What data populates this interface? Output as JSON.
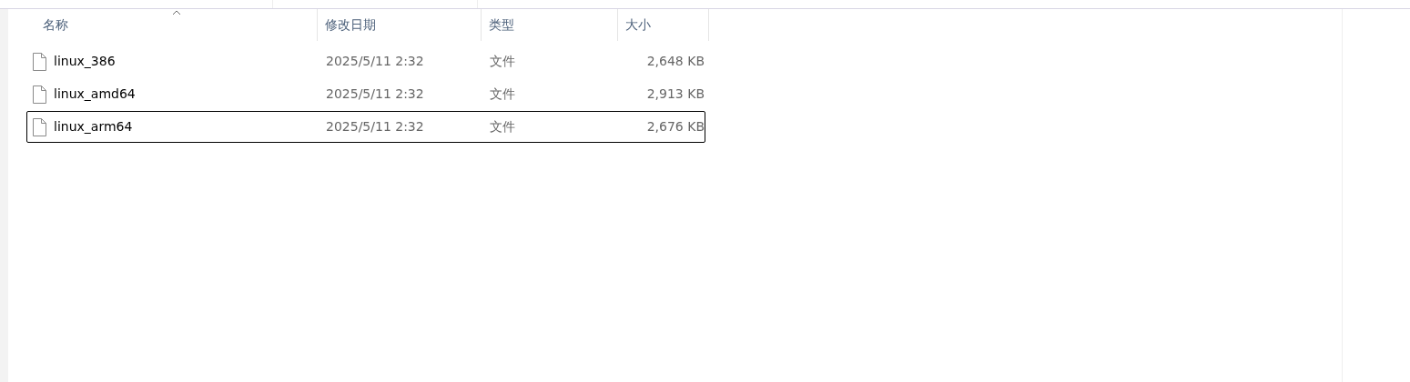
{
  "file_list": {
    "columns": [
      {
        "label": "名称",
        "sorted": true
      },
      {
        "label": "修改日期",
        "sorted": false
      },
      {
        "label": "类型",
        "sorted": false
      },
      {
        "label": "大小",
        "sorted": false
      }
    ],
    "rows": [
      {
        "name": "linux_386",
        "modified": "2025/5/11 2:32",
        "type": "文件",
        "size": "2,648 KB",
        "focused": false
      },
      {
        "name": "linux_amd64",
        "modified": "2025/5/11 2:32",
        "type": "文件",
        "size": "2,913 KB",
        "focused": false
      },
      {
        "name": "linux_arm64",
        "modified": "2025/5/11 2:32",
        "type": "文件",
        "size": "2,676 KB",
        "focused": true
      }
    ]
  }
}
